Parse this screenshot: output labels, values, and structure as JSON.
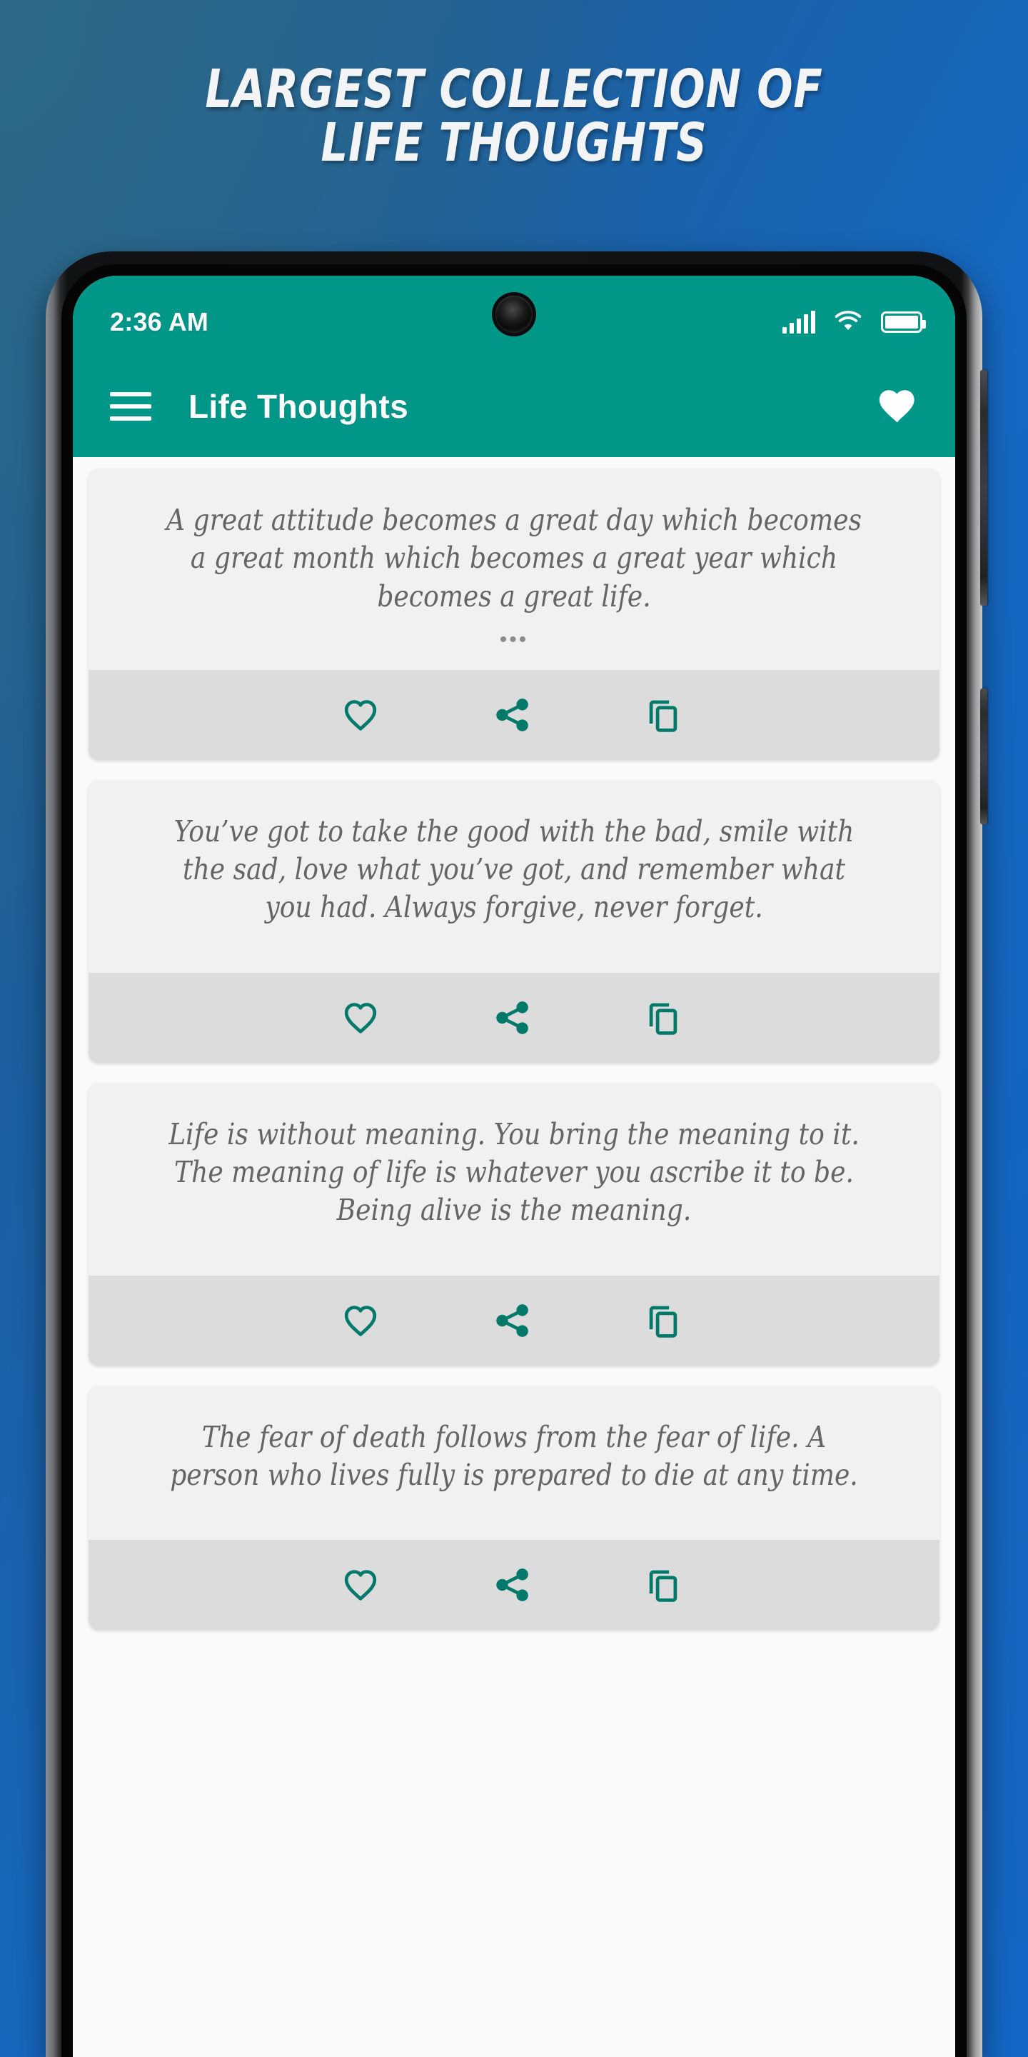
{
  "promo": {
    "headline": "LARGEST COLLECTION OF\nLIFE THOUGHTS",
    "background_color_start": "#2a6486",
    "background_color_end": "#1464bd",
    "headline_color": "#f2f4f5"
  },
  "phone": {
    "accent_color": "#009688",
    "screen_background": "#fafafa",
    "side_buttons": [
      "volume-rocker",
      "power-button"
    ],
    "camera": "punch-hole-camera"
  },
  "status_bar": {
    "time": "2:36 AM",
    "icons": [
      "signal-icon",
      "wifi-icon",
      "battery-icon"
    ],
    "signal_bars": 5,
    "battery_level": "full"
  },
  "app_bar": {
    "menu_icon": "hamburger-menu-icon",
    "title": "Life Thoughts",
    "favorites_icon": "heart-filled-icon"
  },
  "actions": {
    "favorite_label": "heart-outline-icon",
    "share_label": "share-icon",
    "copy_label": "copy-icon"
  },
  "quotes": [
    {
      "text": "A great attitude becomes a great day which becomes a great month which becomes a great year which becomes a great life.",
      "ellipsis": "•••",
      "has_ellipsis": true
    },
    {
      "text": "You’ve got to take the good with the bad, smile with the sad, love what you’ve got, and remember what you had. Always forgive, never forget.",
      "ellipsis": "",
      "has_ellipsis": false
    },
    {
      "text": "Life is without meaning. You bring the meaning to it. The meaning of life is whatever you ascribe it to be. Being alive is the meaning.",
      "ellipsis": "",
      "has_ellipsis": false
    },
    {
      "text": "The fear of death follows from the fear of life. A person who lives fully is prepared to die at any time.",
      "ellipsis": "",
      "has_ellipsis": false
    }
  ],
  "colors": {
    "teal": "#009688",
    "card_background": "#f1f1f1",
    "action_background": "#dcdcdc",
    "quote_text": "#656565",
    "icon_teal": "#00796b"
  }
}
